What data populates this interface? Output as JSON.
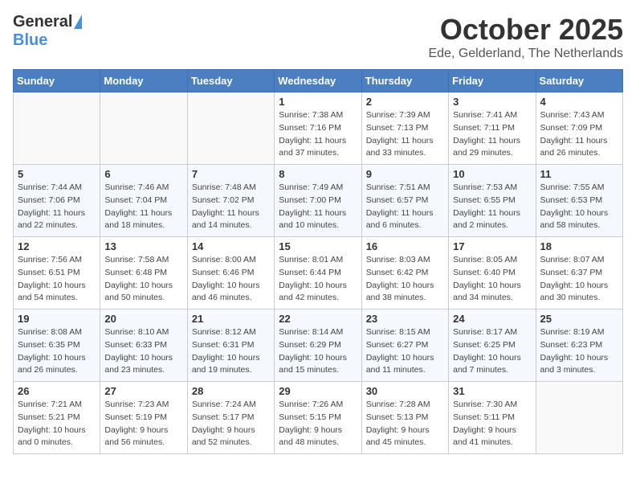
{
  "header": {
    "logo_general": "General",
    "logo_blue": "Blue",
    "title": "October 2025",
    "location": "Ede, Gelderland, The Netherlands"
  },
  "columns": [
    "Sunday",
    "Monday",
    "Tuesday",
    "Wednesday",
    "Thursday",
    "Friday",
    "Saturday"
  ],
  "weeks": [
    [
      {
        "day": "",
        "info": ""
      },
      {
        "day": "",
        "info": ""
      },
      {
        "day": "",
        "info": ""
      },
      {
        "day": "1",
        "info": "Sunrise: 7:38 AM\nSunset: 7:16 PM\nDaylight: 11 hours\nand 37 minutes."
      },
      {
        "day": "2",
        "info": "Sunrise: 7:39 AM\nSunset: 7:13 PM\nDaylight: 11 hours\nand 33 minutes."
      },
      {
        "day": "3",
        "info": "Sunrise: 7:41 AM\nSunset: 7:11 PM\nDaylight: 11 hours\nand 29 minutes."
      },
      {
        "day": "4",
        "info": "Sunrise: 7:43 AM\nSunset: 7:09 PM\nDaylight: 11 hours\nand 26 minutes."
      }
    ],
    [
      {
        "day": "5",
        "info": "Sunrise: 7:44 AM\nSunset: 7:06 PM\nDaylight: 11 hours\nand 22 minutes."
      },
      {
        "day": "6",
        "info": "Sunrise: 7:46 AM\nSunset: 7:04 PM\nDaylight: 11 hours\nand 18 minutes."
      },
      {
        "day": "7",
        "info": "Sunrise: 7:48 AM\nSunset: 7:02 PM\nDaylight: 11 hours\nand 14 minutes."
      },
      {
        "day": "8",
        "info": "Sunrise: 7:49 AM\nSunset: 7:00 PM\nDaylight: 11 hours\nand 10 minutes."
      },
      {
        "day": "9",
        "info": "Sunrise: 7:51 AM\nSunset: 6:57 PM\nDaylight: 11 hours\nand 6 minutes."
      },
      {
        "day": "10",
        "info": "Sunrise: 7:53 AM\nSunset: 6:55 PM\nDaylight: 11 hours\nand 2 minutes."
      },
      {
        "day": "11",
        "info": "Sunrise: 7:55 AM\nSunset: 6:53 PM\nDaylight: 10 hours\nand 58 minutes."
      }
    ],
    [
      {
        "day": "12",
        "info": "Sunrise: 7:56 AM\nSunset: 6:51 PM\nDaylight: 10 hours\nand 54 minutes."
      },
      {
        "day": "13",
        "info": "Sunrise: 7:58 AM\nSunset: 6:48 PM\nDaylight: 10 hours\nand 50 minutes."
      },
      {
        "day": "14",
        "info": "Sunrise: 8:00 AM\nSunset: 6:46 PM\nDaylight: 10 hours\nand 46 minutes."
      },
      {
        "day": "15",
        "info": "Sunrise: 8:01 AM\nSunset: 6:44 PM\nDaylight: 10 hours\nand 42 minutes."
      },
      {
        "day": "16",
        "info": "Sunrise: 8:03 AM\nSunset: 6:42 PM\nDaylight: 10 hours\nand 38 minutes."
      },
      {
        "day": "17",
        "info": "Sunrise: 8:05 AM\nSunset: 6:40 PM\nDaylight: 10 hours\nand 34 minutes."
      },
      {
        "day": "18",
        "info": "Sunrise: 8:07 AM\nSunset: 6:37 PM\nDaylight: 10 hours\nand 30 minutes."
      }
    ],
    [
      {
        "day": "19",
        "info": "Sunrise: 8:08 AM\nSunset: 6:35 PM\nDaylight: 10 hours\nand 26 minutes."
      },
      {
        "day": "20",
        "info": "Sunrise: 8:10 AM\nSunset: 6:33 PM\nDaylight: 10 hours\nand 23 minutes."
      },
      {
        "day": "21",
        "info": "Sunrise: 8:12 AM\nSunset: 6:31 PM\nDaylight: 10 hours\nand 19 minutes."
      },
      {
        "day": "22",
        "info": "Sunrise: 8:14 AM\nSunset: 6:29 PM\nDaylight: 10 hours\nand 15 minutes."
      },
      {
        "day": "23",
        "info": "Sunrise: 8:15 AM\nSunset: 6:27 PM\nDaylight: 10 hours\nand 11 minutes."
      },
      {
        "day": "24",
        "info": "Sunrise: 8:17 AM\nSunset: 6:25 PM\nDaylight: 10 hours\nand 7 minutes."
      },
      {
        "day": "25",
        "info": "Sunrise: 8:19 AM\nSunset: 6:23 PM\nDaylight: 10 hours\nand 3 minutes."
      }
    ],
    [
      {
        "day": "26",
        "info": "Sunrise: 7:21 AM\nSunset: 5:21 PM\nDaylight: 10 hours\nand 0 minutes."
      },
      {
        "day": "27",
        "info": "Sunrise: 7:23 AM\nSunset: 5:19 PM\nDaylight: 9 hours\nand 56 minutes."
      },
      {
        "day": "28",
        "info": "Sunrise: 7:24 AM\nSunset: 5:17 PM\nDaylight: 9 hours\nand 52 minutes."
      },
      {
        "day": "29",
        "info": "Sunrise: 7:26 AM\nSunset: 5:15 PM\nDaylight: 9 hours\nand 48 minutes."
      },
      {
        "day": "30",
        "info": "Sunrise: 7:28 AM\nSunset: 5:13 PM\nDaylight: 9 hours\nand 45 minutes."
      },
      {
        "day": "31",
        "info": "Sunrise: 7:30 AM\nSunset: 5:11 PM\nDaylight: 9 hours\nand 41 minutes."
      },
      {
        "day": "",
        "info": ""
      }
    ]
  ]
}
